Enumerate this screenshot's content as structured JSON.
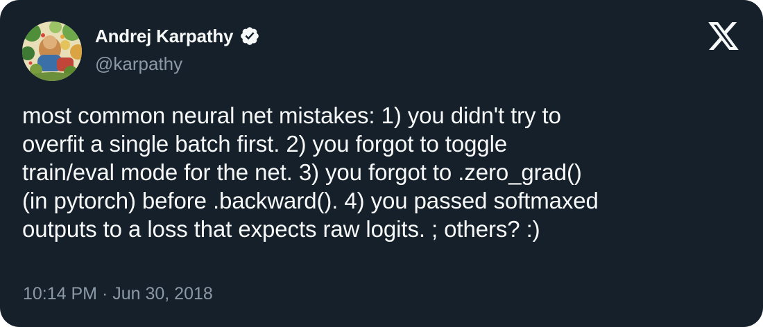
{
  "author": {
    "display_name": "Andrej Karpathy",
    "handle": "@karpathy",
    "verified": true
  },
  "tweet": {
    "text": "most common neural net mistakes: 1) you didn't try to\noverfit a single batch first. 2) you forgot to toggle\ntrain/eval mode for the net. 3) you forgot to .zero_grad()\n(in pytorch) before .backward(). 4) you passed softmaxed\noutputs to a loss that expects raw logits. ; others? :)",
    "timestamp": "10:14 PM · Jun 30, 2018"
  },
  "icons": {
    "avatar": "avatar-illustration",
    "verified": "verified-badge-icon",
    "platform": "x-logo-icon"
  },
  "colors": {
    "background": "#15202b",
    "text_primary": "#f7f9f9",
    "text_secondary": "#8b98a5"
  }
}
